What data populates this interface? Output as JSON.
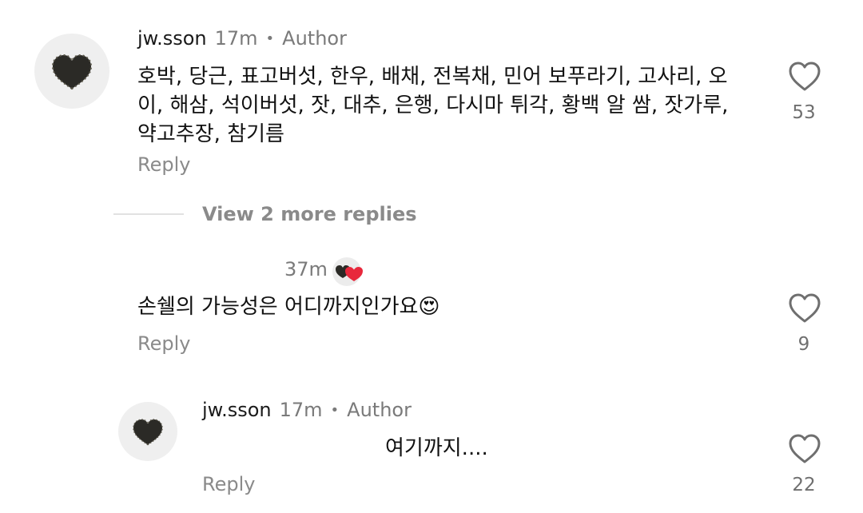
{
  "comments": [
    {
      "username": "jw.sson",
      "time": "17m",
      "dot": "•",
      "badge": "Author",
      "text_lines": [
        "호박, 당근, 표고버섯, 한우, 배채, 전복채, 민어 보푸라기, 고사리, 오",
        "이, 해삼, 석이버섯, 잣, 대추, 은행, 다시마 튀각, 황백 알 쌈, 잣가루,",
        "약고추장, 참기름"
      ],
      "reply_label": "Reply",
      "likes": "53",
      "avatar_icon": "heart-caviar-avatar",
      "like_icon": "heart-outline-icon"
    },
    {
      "time": "37m",
      "text": "손쉘의 가능성은 어디까지인가요",
      "emoji": "😍",
      "reply_label": "Reply",
      "likes": "9",
      "avatar_icon": "heart-caviar-with-red-heart-avatar",
      "like_icon": "heart-outline-icon"
    },
    {
      "username": "jw.sson",
      "time": "17m",
      "dot": "•",
      "badge": "Author",
      "text": "여기까지....",
      "reply_label": "Reply",
      "likes": "22",
      "avatar_icon": "heart-caviar-avatar",
      "like_icon": "heart-outline-icon"
    }
  ],
  "more_replies": "View 2 more replies",
  "colors": {
    "text": "#111111",
    "muted": "#7a7a7a",
    "avatar_bg": "#efefef",
    "red_heart": "#e8283c"
  }
}
